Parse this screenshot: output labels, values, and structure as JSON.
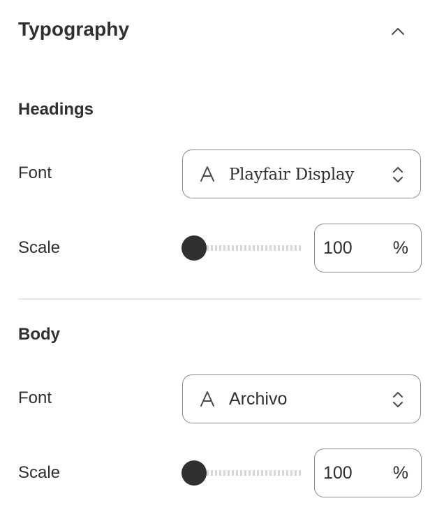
{
  "panel": {
    "title": "Typography",
    "collapse_icon": "chevron-up-icon"
  },
  "headings": {
    "section_title": "Headings",
    "font_label": "Font",
    "font_value": "Playfair Display",
    "scale_label": "Scale",
    "scale_value": "100",
    "scale_unit": "%",
    "scale_slider_level": 0
  },
  "body": {
    "section_title": "Body",
    "font_label": "Font",
    "font_value": "Archivo",
    "scale_label": "Scale",
    "scale_value": "100",
    "scale_unit": "%",
    "scale_slider_level": 0
  },
  "icons": {
    "font_select": "font-letter-icon",
    "select_arrows": "up-down-chevron-icon"
  },
  "colors": {
    "text": "#303030",
    "border": "#8a8a8a",
    "divider": "#e8e8e8",
    "slider_thumb": "#303030",
    "slider_track": "#d6d6d6"
  }
}
